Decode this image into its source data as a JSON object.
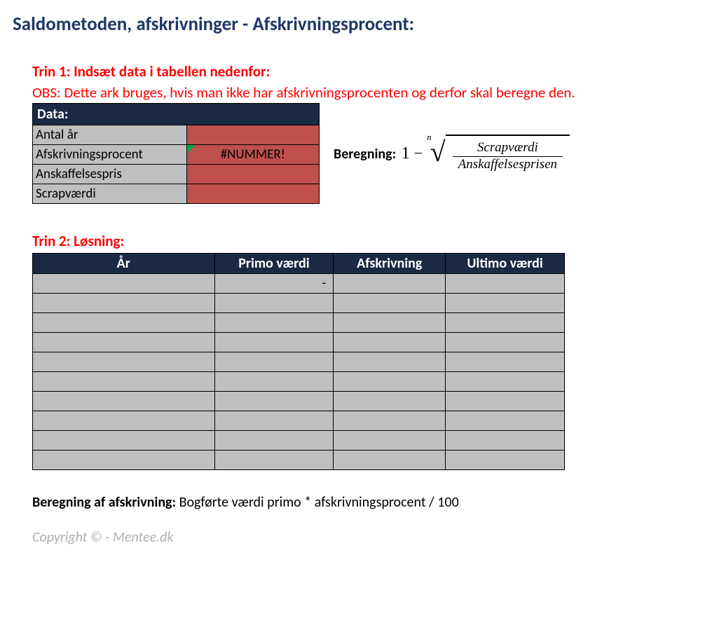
{
  "page": {
    "title": "Saldometoden, afskrivninger - Afskrivningsprocent:"
  },
  "step1": {
    "heading": "Trin 1: Indsæt data i tabellen nedenfor:",
    "obs": "OBS: Dette ark bruges, hvis man ikke har afskrivningsprocenten og derfor skal beregne den.",
    "table_header": "Data:",
    "rows": {
      "antal_aar": {
        "label": "Antal år",
        "value": ""
      },
      "afskrivningspct": {
        "label": "Afskrivningsprocent",
        "value": "#NUMMER!"
      },
      "anskaffelsespris": {
        "label": "Anskaffelsespris",
        "value": ""
      },
      "scrapvaerdi": {
        "label": "Scrapværdi",
        "value": ""
      }
    },
    "beregning_label": "Beregning:",
    "formula": {
      "one": "1",
      "minus": "−",
      "degree": "n",
      "numerator": "Scrapværdi",
      "denominator": "Anskaffelsesprisen"
    }
  },
  "step2": {
    "heading": "Trin 2: Løsning:",
    "headers": {
      "year": "År",
      "primo": "Primo værdi",
      "afskrivning": "Afskrivning",
      "ultimo": "Ultimo værdi"
    },
    "rows": [
      {
        "year": "",
        "primo": " - ",
        "afskrivning": "",
        "ultimo": ""
      },
      {
        "year": "",
        "primo": "",
        "afskrivning": "",
        "ultimo": ""
      },
      {
        "year": "",
        "primo": "",
        "afskrivning": "",
        "ultimo": ""
      },
      {
        "year": "",
        "primo": "",
        "afskrivning": "",
        "ultimo": ""
      },
      {
        "year": "",
        "primo": "",
        "afskrivning": "",
        "ultimo": ""
      },
      {
        "year": "",
        "primo": "",
        "afskrivning": "",
        "ultimo": ""
      },
      {
        "year": "",
        "primo": "",
        "afskrivning": "",
        "ultimo": ""
      },
      {
        "year": "",
        "primo": "",
        "afskrivning": "",
        "ultimo": ""
      },
      {
        "year": "",
        "primo": "",
        "afskrivning": "",
        "ultimo": ""
      },
      {
        "year": "",
        "primo": "",
        "afskrivning": "",
        "ultimo": ""
      }
    ]
  },
  "calc_note": {
    "bold": "Beregning af afskrivning: ",
    "text": "Bogførte værdi primo * afskrivningsprocent / 100"
  },
  "copyright": "Copyright © - Mentee.dk"
}
